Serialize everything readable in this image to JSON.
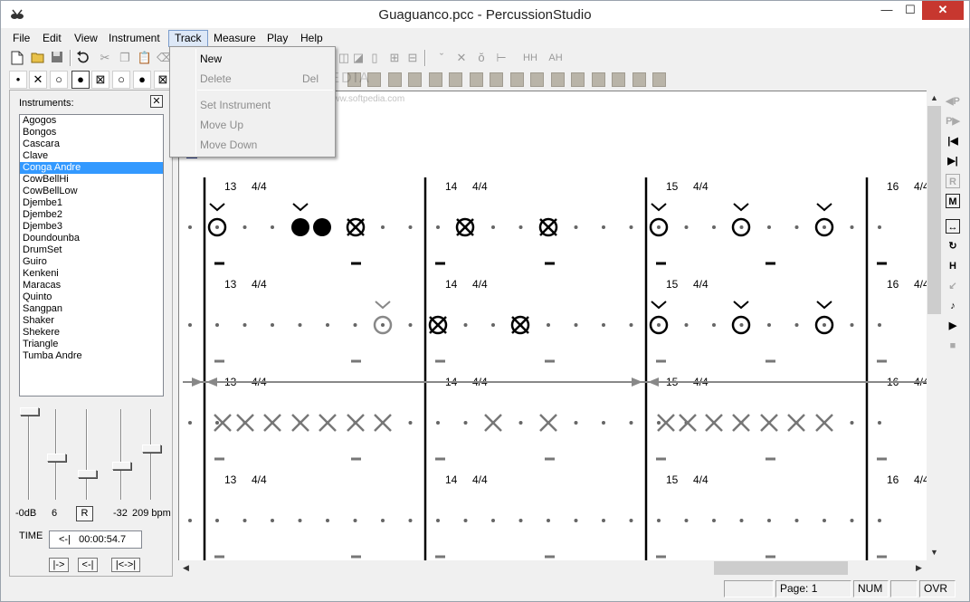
{
  "window": {
    "title": "Guaguanco.pcc - PercussionStudio",
    "minimize": "—",
    "maximize": "☐",
    "close": "✕"
  },
  "menubar": [
    "File",
    "Edit",
    "View",
    "Instrument",
    "Track",
    "Measure",
    "Play",
    "Help"
  ],
  "track_menu": {
    "items": [
      {
        "label": "New",
        "shortcut": "",
        "enabled": true
      },
      {
        "label": "Delete",
        "shortcut": "Del",
        "enabled": false
      },
      {
        "label": "Set Instrument",
        "shortcut": "",
        "enabled": false
      },
      {
        "label": "Move Up",
        "shortcut": "",
        "enabled": false
      },
      {
        "label": "Move Down",
        "shortcut": "",
        "enabled": false
      }
    ]
  },
  "toolbar_row2": {
    "stroke_symbols": [
      "•",
      "✕",
      "○",
      "●",
      "⊠",
      "○",
      "●",
      "⊠"
    ]
  },
  "toolbar_labels": {
    "hh": "HH",
    "ah": "AH"
  },
  "watermark": {
    "main": "SOFTPEDIA",
    "sub": "www.softpedia.com"
  },
  "sidebar": {
    "instruments_label": "Instruments:",
    "close_symbol": "✕",
    "instruments": [
      "Agogos",
      "Bongos",
      "Cascara",
      "Clave",
      "Conga Andre",
      "CowBellHi",
      "CowBellLow",
      "Djembe1",
      "Djembe2",
      "Djembe3",
      "Doundounba",
      "DrumSet",
      "Guiro",
      "Kenkeni",
      "Maracas",
      "Quinto",
      "Sangpan",
      "Shaker",
      "Shekere",
      "Triangle",
      "Tumba Andre"
    ],
    "selected_instrument": "Conga Andre",
    "sliders": {
      "volume_label": "-0dB",
      "volume_level": 0.0,
      "pan_label": "6",
      "pan_level": 0.55,
      "reset_label": "R",
      "reset_level": 0.75,
      "offset_label": "-32",
      "offset_level": 0.65,
      "tempo_label": "209 bpm",
      "tempo_level": 0.45
    },
    "time_label": "TIME",
    "time_value": "<-|   00:00:54.7",
    "nav_buttons": [
      "|->",
      "<-|",
      "|<->|"
    ]
  },
  "score": {
    "tracks": [
      {
        "measures": [
          {
            "number": "13",
            "signature": "4/4"
          },
          {
            "number": "14",
            "signature": "4/4"
          },
          {
            "number": "15",
            "signature": "4/4"
          },
          {
            "number": "16",
            "signature": "4/4"
          }
        ]
      },
      {
        "measures": [
          {
            "number": "13",
            "signature": "4/4"
          },
          {
            "number": "14",
            "signature": "4/4"
          },
          {
            "number": "15",
            "signature": "4/4"
          },
          {
            "number": "16",
            "signature": "4/4"
          }
        ]
      },
      {
        "measures": [
          {
            "number": "13",
            "signature": "4/4"
          },
          {
            "number": "14",
            "signature": "4/4"
          },
          {
            "number": "15",
            "signature": "4/4"
          },
          {
            "number": "16",
            "signature": "4/4"
          }
        ]
      },
      {
        "measures": [
          {
            "number": "13",
            "signature": "4/4"
          },
          {
            "number": "14",
            "signature": "4/4"
          },
          {
            "number": "15",
            "signature": "4/4"
          },
          {
            "number": "16",
            "signature": "4/4"
          }
        ]
      }
    ]
  },
  "right_tools": [
    "◀P",
    "P▶",
    "|◀",
    "▶|",
    "R",
    "M",
    "↔",
    "↻",
    "H",
    "↙",
    "♪",
    "▶",
    "■"
  ],
  "status": {
    "page": "Page: 1",
    "num": "NUM",
    "ovr": "OVR"
  }
}
